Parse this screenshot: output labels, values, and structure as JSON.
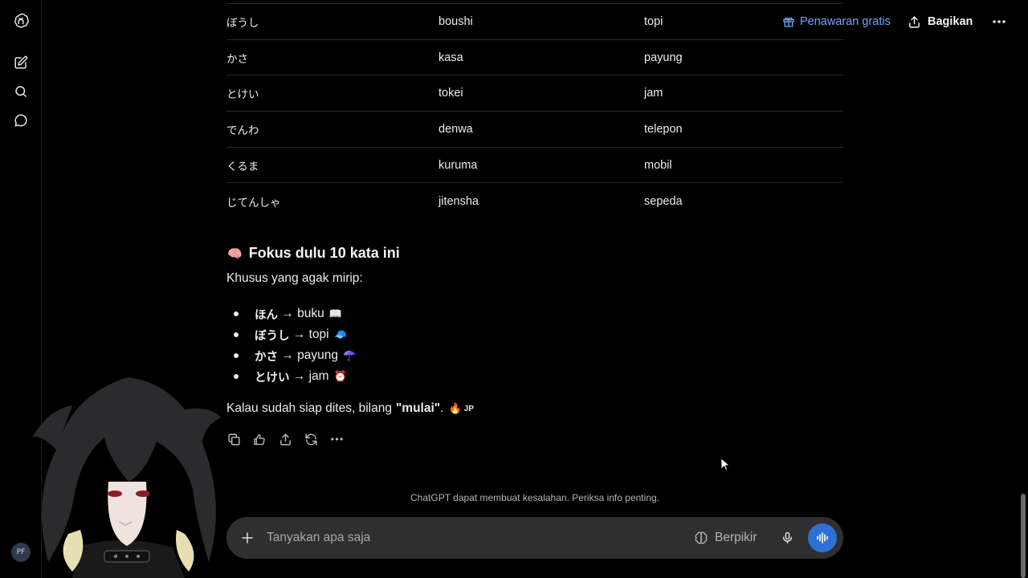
{
  "topbar": {
    "offer_label": "Penawaran gratis",
    "share_label": "Bagikan"
  },
  "sidebar": {
    "user_initials": "PF"
  },
  "vocab_table": {
    "rows": [
      [
        "ぼうし",
        "boushi",
        "topi"
      ],
      [
        "かさ",
        "kasa",
        "payung"
      ],
      [
        "とけい",
        "tokei",
        "jam"
      ],
      [
        "でんわ",
        "denwa",
        "telepon"
      ],
      [
        "くるま",
        "kuruma",
        "mobil"
      ],
      [
        "じてんしゃ",
        "jitensha",
        "sepeda"
      ]
    ]
  },
  "message": {
    "heading_emoji": "🧠",
    "heading": "Fokus dulu 10 kata ini",
    "intro": "Khusus yang agak mirip:",
    "bullets": [
      {
        "kana": "ほん",
        "arrow": " → buku",
        "emoji": "📖"
      },
      {
        "kana": "ぼうし",
        "arrow": " → topi",
        "emoji": "🧢"
      },
      {
        "kana": "かさ",
        "arrow": " → payung",
        "emoji": "☂️"
      },
      {
        "kana": "とけい",
        "arrow": " → jam",
        "emoji": "⏰"
      }
    ],
    "closing_prefix": "Kalau sudah siap dites, bilang",
    "closing_bold": "\"mulai\"",
    "closing_suffix": ".",
    "closing_emoji": "🔥",
    "closing_flag": "JP"
  },
  "disclaimer": "ChatGPT dapat membuat kesalahan. Periksa info penting.",
  "composer": {
    "placeholder": "Tanyakan apa saja",
    "think_label": "Berpikir"
  },
  "colors": {
    "accent": "#6ea8fe",
    "voice_button": "#2f6fd6",
    "composer_bg": "#2f2f2f"
  }
}
